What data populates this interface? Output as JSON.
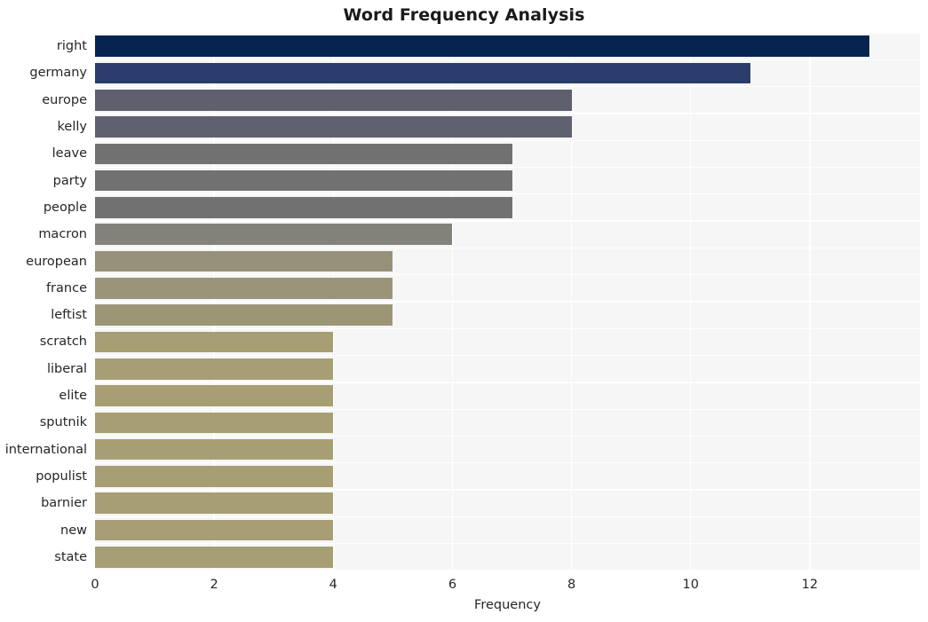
{
  "chart_data": {
    "type": "bar",
    "orientation": "horizontal",
    "title": "Word Frequency Analysis",
    "xlabel": "Frequency",
    "ylabel": "",
    "categories": [
      "right",
      "germany",
      "europe",
      "kelly",
      "leave",
      "party",
      "people",
      "macron",
      "european",
      "france",
      "leftist",
      "scratch",
      "liberal",
      "elite",
      "sputnik",
      "international",
      "populist",
      "barnier",
      "new",
      "state"
    ],
    "values": [
      13,
      11,
      8,
      8,
      7,
      7,
      7,
      6,
      5,
      5,
      5,
      4,
      4,
      4,
      4,
      4,
      4,
      4,
      4,
      4
    ],
    "bar_colors": [
      "#06244f",
      "#2a3c6b",
      "#5e606e",
      "#5f6170",
      "#717171",
      "#717171",
      "#717171",
      "#83827a",
      "#97917a",
      "#9a9478",
      "#9c9677",
      "#a79e73",
      "#a79e73",
      "#a79e73",
      "#a79e73",
      "#a79e73",
      "#a79e73",
      "#a79e73",
      "#a79e73",
      "#a79e73"
    ],
    "xlim": [
      0,
      13.85
    ],
    "xticks": [
      0,
      2,
      4,
      6,
      8,
      10,
      12
    ],
    "xticklabels": [
      "0",
      "2",
      "4",
      "6",
      "8",
      "10",
      "12"
    ],
    "grid": true,
    "grid_color": "#ffffff",
    "plot_background": "#f6f6f7",
    "figure_background": "#ffffff",
    "legend": null
  }
}
